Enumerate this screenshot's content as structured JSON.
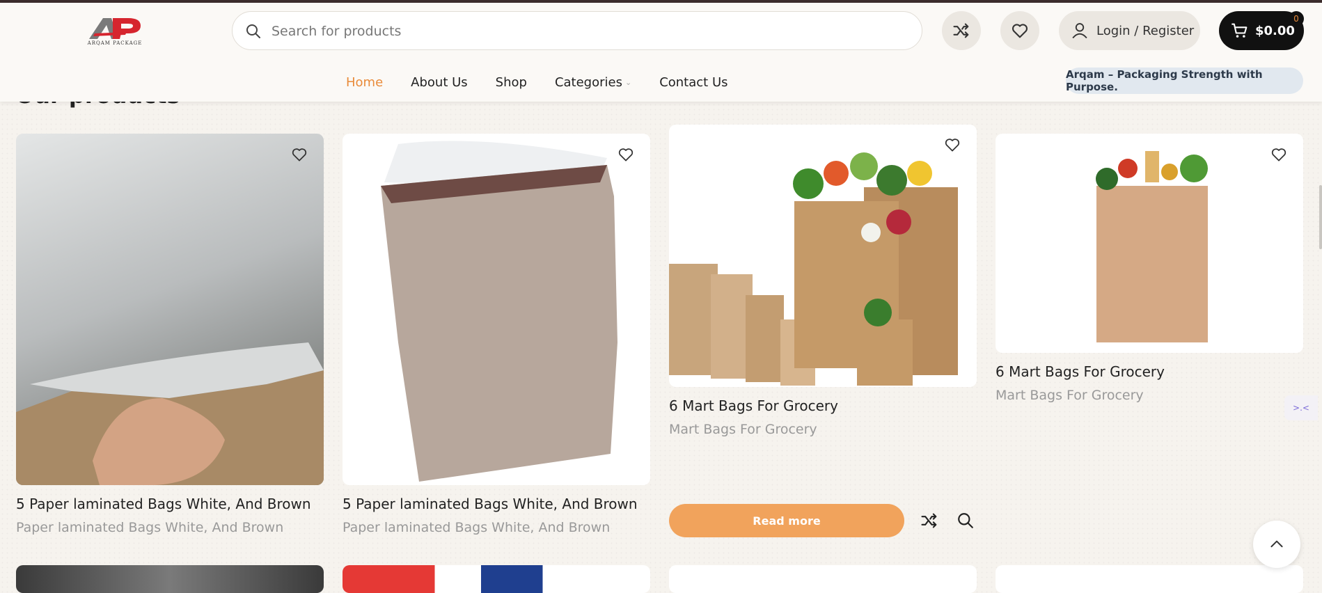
{
  "header": {
    "logo_text": "ARQAM PACKAGE",
    "search_placeholder": "Search for products",
    "login_label": "Login / Register",
    "cart_total": "$0.00",
    "cart_count": "0",
    "tagline": "Arqam – Packaging Strength with Purpose."
  },
  "nav": {
    "items": [
      "Home",
      "About Us",
      "Shop",
      "Categories",
      "Contact Us"
    ]
  },
  "section": {
    "title": "Our products"
  },
  "products": [
    {
      "title": "5 Paper laminated Bags White, And Brown",
      "category": "Paper laminated Bags White, And Brown"
    },
    {
      "title": "5 Paper laminated Bags White, And Brown",
      "category": "Paper laminated Bags White, And Brown"
    },
    {
      "title": "6 Mart Bags For Grocery",
      "category": "Mart Bags For Grocery",
      "button": "Read more"
    },
    {
      "title": "6 Mart Bags For Grocery",
      "category": "Mart Bags For Grocery"
    }
  ],
  "side_widget": ">.<",
  "colors": {
    "accent": "#e98b3a",
    "button": "#f1a35c",
    "cart_bg": "#111111"
  }
}
